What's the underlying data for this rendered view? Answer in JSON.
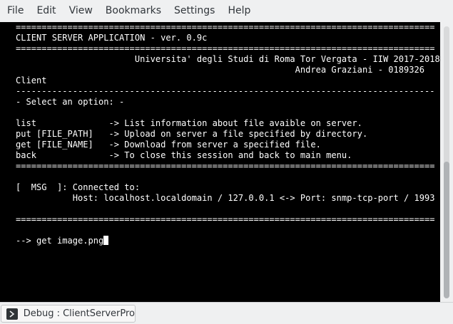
{
  "menubar": {
    "items": [
      {
        "label": "File"
      },
      {
        "label": "Edit"
      },
      {
        "label": "View"
      },
      {
        "label": "Bookmarks"
      },
      {
        "label": "Settings"
      },
      {
        "label": "Help"
      }
    ]
  },
  "terminal": {
    "lines": [
      "=================================================================================",
      "CLIENT SERVER APPLICATION - ver. 0.9c",
      "=================================================================================",
      "                       Universita' degli Studi di Roma Tor Vergata - IIW 2017-2018",
      "                                                      Andrea Graziani - 0189326",
      "Client",
      "---------------------------------------------------------------------------------",
      "- Select an option: -",
      "",
      "list              -> List information about file avaible on server.",
      "put [FILE_PATH]   -> Upload on server a file specified by directory.",
      "get [FILE_NAME]   -> Download from server a specified file.",
      "back              -> To close this session and back to main menu.",
      "=================================================================================",
      "",
      "[  MSG  ]: Connected to:",
      "           Host: localhost.localdomain / 127.0.0.1 <-> Port: snmp-tcp-port / 1993",
      "",
      "=================================================================================",
      "",
      "--> get image.png"
    ]
  },
  "statusbar": {
    "tab_label": "Debug : ClientServerPro"
  }
}
